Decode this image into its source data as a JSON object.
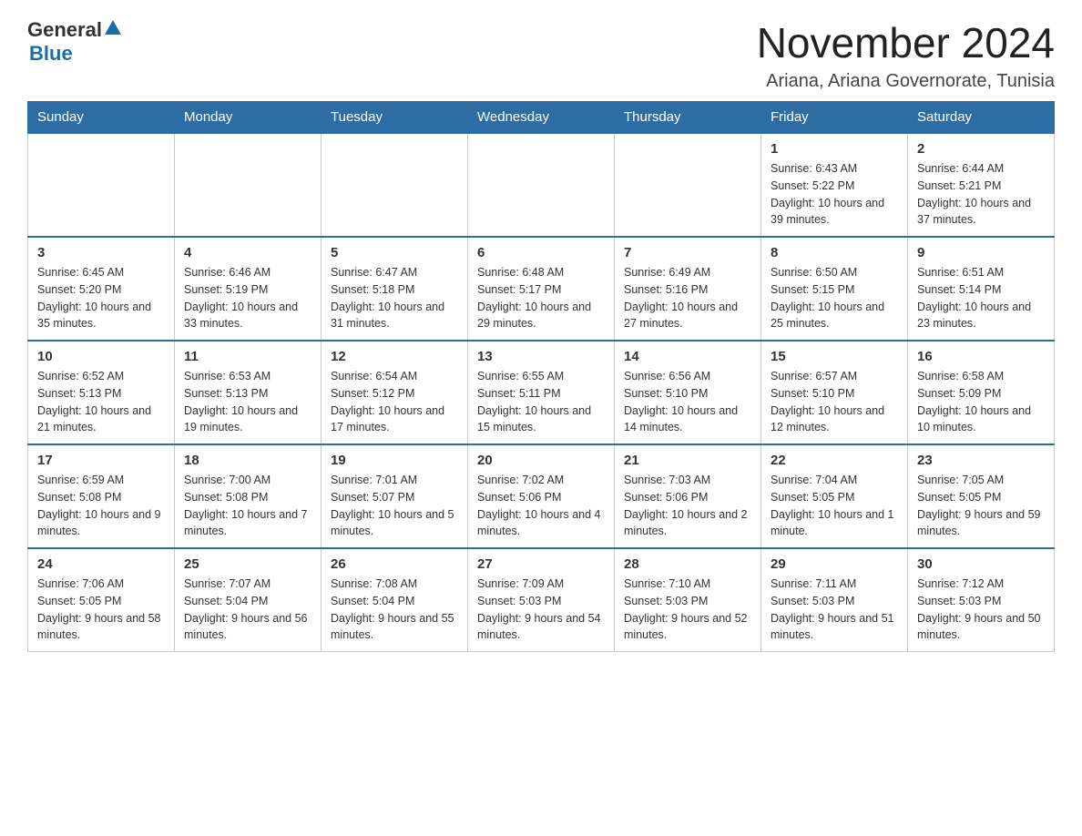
{
  "header": {
    "logo": {
      "line1": "General",
      "triangle": "▲",
      "line2": "Blue"
    },
    "title": "November 2024",
    "subtitle": "Ariana, Ariana Governorate, Tunisia"
  },
  "calendar": {
    "days_of_week": [
      "Sunday",
      "Monday",
      "Tuesday",
      "Wednesday",
      "Thursday",
      "Friday",
      "Saturday"
    ],
    "weeks": [
      {
        "cells": [
          {
            "day": "",
            "info": ""
          },
          {
            "day": "",
            "info": ""
          },
          {
            "day": "",
            "info": ""
          },
          {
            "day": "",
            "info": ""
          },
          {
            "day": "",
            "info": ""
          },
          {
            "day": "1",
            "info": "Sunrise: 6:43 AM\nSunset: 5:22 PM\nDaylight: 10 hours and 39 minutes."
          },
          {
            "day": "2",
            "info": "Sunrise: 6:44 AM\nSunset: 5:21 PM\nDaylight: 10 hours and 37 minutes."
          }
        ]
      },
      {
        "cells": [
          {
            "day": "3",
            "info": "Sunrise: 6:45 AM\nSunset: 5:20 PM\nDaylight: 10 hours and 35 minutes."
          },
          {
            "day": "4",
            "info": "Sunrise: 6:46 AM\nSunset: 5:19 PM\nDaylight: 10 hours and 33 minutes."
          },
          {
            "day": "5",
            "info": "Sunrise: 6:47 AM\nSunset: 5:18 PM\nDaylight: 10 hours and 31 minutes."
          },
          {
            "day": "6",
            "info": "Sunrise: 6:48 AM\nSunset: 5:17 PM\nDaylight: 10 hours and 29 minutes."
          },
          {
            "day": "7",
            "info": "Sunrise: 6:49 AM\nSunset: 5:16 PM\nDaylight: 10 hours and 27 minutes."
          },
          {
            "day": "8",
            "info": "Sunrise: 6:50 AM\nSunset: 5:15 PM\nDaylight: 10 hours and 25 minutes."
          },
          {
            "day": "9",
            "info": "Sunrise: 6:51 AM\nSunset: 5:14 PM\nDaylight: 10 hours and 23 minutes."
          }
        ]
      },
      {
        "cells": [
          {
            "day": "10",
            "info": "Sunrise: 6:52 AM\nSunset: 5:13 PM\nDaylight: 10 hours and 21 minutes."
          },
          {
            "day": "11",
            "info": "Sunrise: 6:53 AM\nSunset: 5:13 PM\nDaylight: 10 hours and 19 minutes."
          },
          {
            "day": "12",
            "info": "Sunrise: 6:54 AM\nSunset: 5:12 PM\nDaylight: 10 hours and 17 minutes."
          },
          {
            "day": "13",
            "info": "Sunrise: 6:55 AM\nSunset: 5:11 PM\nDaylight: 10 hours and 15 minutes."
          },
          {
            "day": "14",
            "info": "Sunrise: 6:56 AM\nSunset: 5:10 PM\nDaylight: 10 hours and 14 minutes."
          },
          {
            "day": "15",
            "info": "Sunrise: 6:57 AM\nSunset: 5:10 PM\nDaylight: 10 hours and 12 minutes."
          },
          {
            "day": "16",
            "info": "Sunrise: 6:58 AM\nSunset: 5:09 PM\nDaylight: 10 hours and 10 minutes."
          }
        ]
      },
      {
        "cells": [
          {
            "day": "17",
            "info": "Sunrise: 6:59 AM\nSunset: 5:08 PM\nDaylight: 10 hours and 9 minutes."
          },
          {
            "day": "18",
            "info": "Sunrise: 7:00 AM\nSunset: 5:08 PM\nDaylight: 10 hours and 7 minutes."
          },
          {
            "day": "19",
            "info": "Sunrise: 7:01 AM\nSunset: 5:07 PM\nDaylight: 10 hours and 5 minutes."
          },
          {
            "day": "20",
            "info": "Sunrise: 7:02 AM\nSunset: 5:06 PM\nDaylight: 10 hours and 4 minutes."
          },
          {
            "day": "21",
            "info": "Sunrise: 7:03 AM\nSunset: 5:06 PM\nDaylight: 10 hours and 2 minutes."
          },
          {
            "day": "22",
            "info": "Sunrise: 7:04 AM\nSunset: 5:05 PM\nDaylight: 10 hours and 1 minute."
          },
          {
            "day": "23",
            "info": "Sunrise: 7:05 AM\nSunset: 5:05 PM\nDaylight: 9 hours and 59 minutes."
          }
        ]
      },
      {
        "cells": [
          {
            "day": "24",
            "info": "Sunrise: 7:06 AM\nSunset: 5:05 PM\nDaylight: 9 hours and 58 minutes."
          },
          {
            "day": "25",
            "info": "Sunrise: 7:07 AM\nSunset: 5:04 PM\nDaylight: 9 hours and 56 minutes."
          },
          {
            "day": "26",
            "info": "Sunrise: 7:08 AM\nSunset: 5:04 PM\nDaylight: 9 hours and 55 minutes."
          },
          {
            "day": "27",
            "info": "Sunrise: 7:09 AM\nSunset: 5:03 PM\nDaylight: 9 hours and 54 minutes."
          },
          {
            "day": "28",
            "info": "Sunrise: 7:10 AM\nSunset: 5:03 PM\nDaylight: 9 hours and 52 minutes."
          },
          {
            "day": "29",
            "info": "Sunrise: 7:11 AM\nSunset: 5:03 PM\nDaylight: 9 hours and 51 minutes."
          },
          {
            "day": "30",
            "info": "Sunrise: 7:12 AM\nSunset: 5:03 PM\nDaylight: 9 hours and 50 minutes."
          }
        ]
      }
    ]
  }
}
